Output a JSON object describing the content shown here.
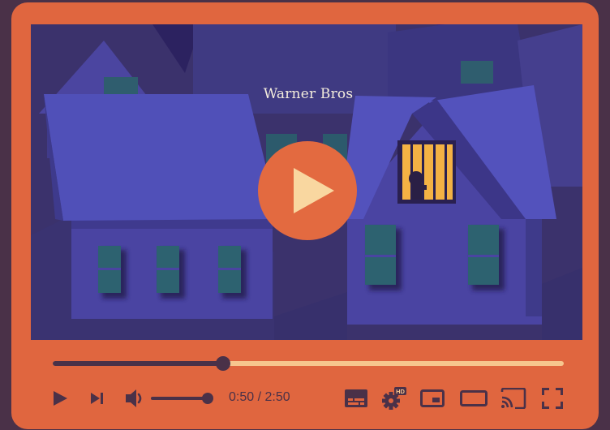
{
  "video": {
    "title": "Warner Bros"
  },
  "playback": {
    "progress_fraction": 0.333,
    "current_time": "0:50",
    "separator": "/",
    "duration": "2:50"
  },
  "volume": {
    "level_fraction": 1.0
  },
  "icons": {
    "big_play": "play-icon",
    "play": "play-icon",
    "next": "skip-next-icon",
    "volume": "volume-icon",
    "subtitles": "subtitles-icon",
    "settings": "gear-hd-icon",
    "settings_badge": "HD",
    "miniplayer": "miniplayer-icon",
    "theater": "theater-mode-icon",
    "cast": "cast-icon",
    "fullscreen": "fullscreen-icon"
  },
  "colors": {
    "frame": "#e0663f",
    "controls": "#4a3148",
    "progress_track": "#f7c68e",
    "play_triangle": "#f9d7a0",
    "night_sky": "#3d3370"
  }
}
